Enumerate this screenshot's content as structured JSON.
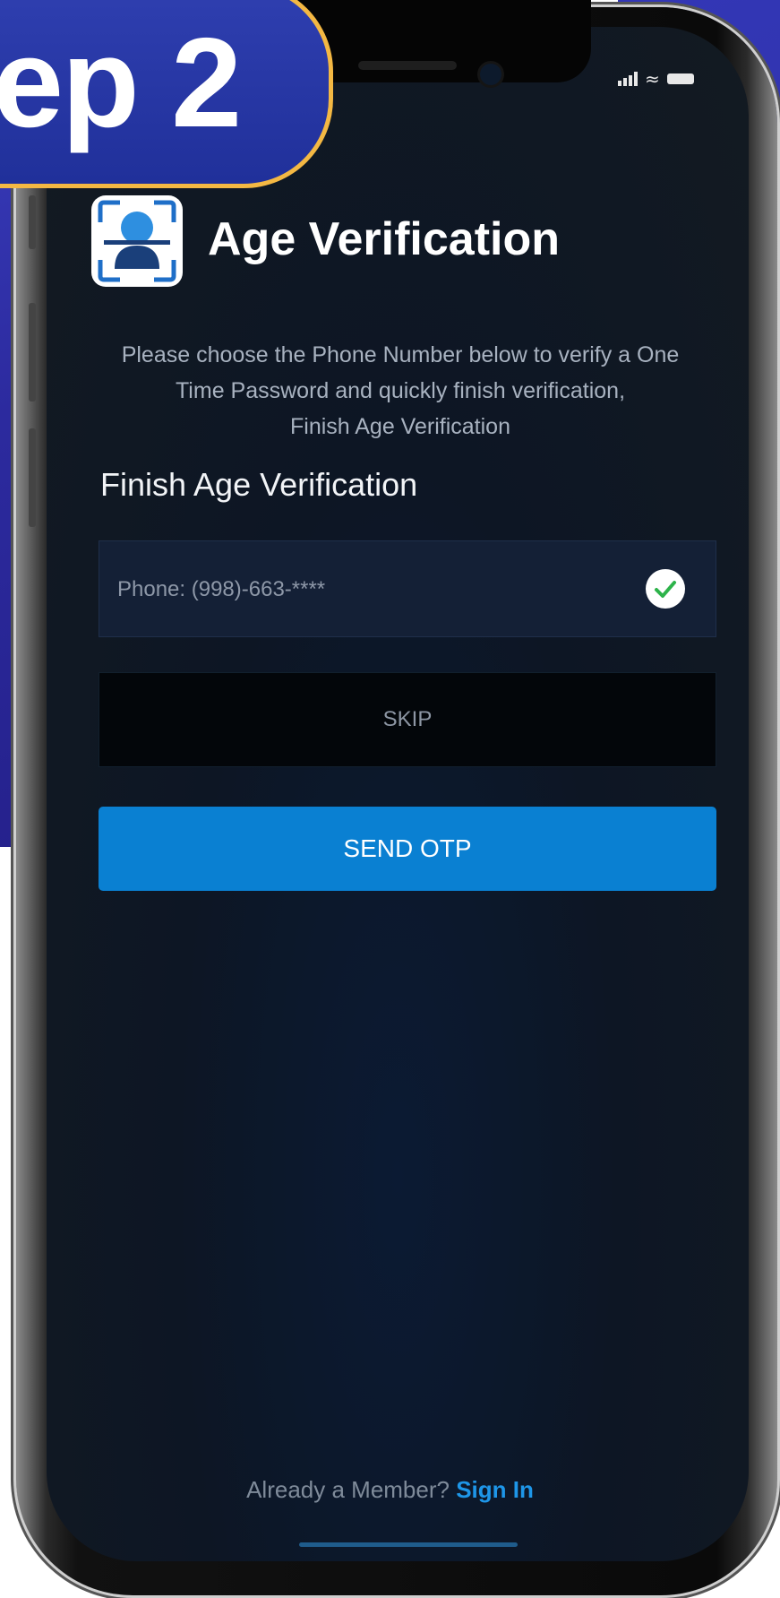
{
  "badge": {
    "text": "ep 2"
  },
  "status_bar": {
    "signal_icon": "signal-icon",
    "wifi_icon": "wifi-icon",
    "battery_icon": "battery-icon"
  },
  "header": {
    "title": "Age Verification",
    "logo_icon": "age-verification-logo-icon"
  },
  "description": {
    "lines": [
      "Please choose the Phone Number below to verify a One",
      "Time Password and quickly finish verification,",
      "Finish Age Verification"
    ]
  },
  "section": {
    "title": "Finish Age Verification"
  },
  "phone_option": {
    "value": "Phone: (998)-663-****",
    "selected": true,
    "check_icon": "check-circle-icon"
  },
  "buttons": {
    "skip_label": "SKIP",
    "send_otp_label": "SEND OTP"
  },
  "footer": {
    "prompt": "Already a Member?",
    "sign_in_label": "Sign In"
  },
  "colors": {
    "accent": "#0A80D2",
    "badge_background": "#2A36A8",
    "badge_border": "#F4B843",
    "check_green": "#2DB34A",
    "link": "#1E96E8"
  }
}
